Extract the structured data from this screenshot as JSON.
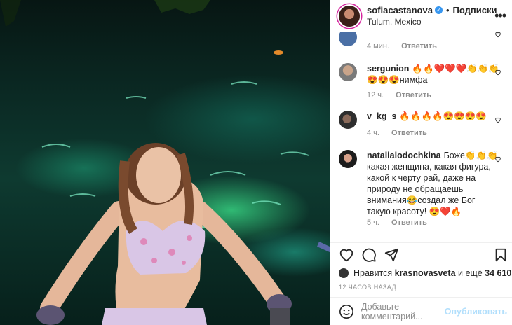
{
  "header": {
    "username": "sofiacastanova",
    "separator": "•",
    "follow_label": "Подписки",
    "location": "Tulum, Mexico",
    "more": "•••"
  },
  "comments": [
    {
      "username": "",
      "text": "",
      "time": "4 мин.",
      "reply": "Ответить"
    },
    {
      "username": "sergunion",
      "text": "🔥🔥❤️❤️❤️👏👏👏😍😍😍нимфа",
      "time": "12 ч.",
      "reply": "Ответить"
    },
    {
      "username": "v_kg_s",
      "text": "🔥🔥🔥🔥😍😍😍😍",
      "time": "4 ч.",
      "reply": "Ответить"
    },
    {
      "username": "natalialodochkina",
      "text": "Боже👏👏👏 какая женщина, какая фигура, какой к черту рай, даже на природу не обращаешь внимания😂создал же Бог такую красоту! 😍❤️🔥",
      "time": "5 ч.",
      "reply": "Ответить"
    }
  ],
  "likes": {
    "prefix": "Нравится",
    "user": "krasnovasveta",
    "middle": "и ещё",
    "count": "34 610"
  },
  "date": "12 ЧАСОВ НАЗАД",
  "add_comment": {
    "placeholder": "Добавьте комментарий...",
    "publish": "Опубликовать"
  },
  "colors": {
    "accent": "#3897f0",
    "publish_disabled": "#b2dffc",
    "muted": "#8e8e8e"
  }
}
